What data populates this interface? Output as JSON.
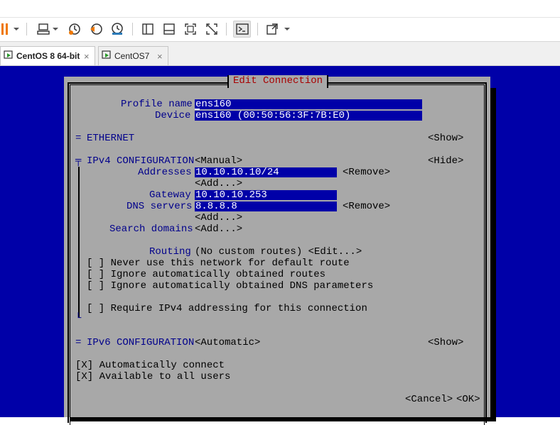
{
  "tabs": [
    {
      "label": "CentOS 8 64-bit",
      "close": "×",
      "active": true
    },
    {
      "label": "CentOS7",
      "close": "×",
      "active": false
    }
  ],
  "toolbar": {
    "icons": [
      "pause-icon",
      "send-keys-icon",
      "snapshot-take-icon",
      "snapshot-revert-icon",
      "snapshot-manager-icon",
      "sidebar-toggle-icon",
      "thumbnail-bar-icon",
      "fullscreen-icon",
      "unity-icon",
      "console-view-icon",
      "stretch-icon"
    ]
  },
  "dialog": {
    "title": "Edit Connection",
    "profile_name_label": "Profile name",
    "profile_name_value": "ens160",
    "device_label": "Device",
    "device_value": "ens160 (00:50:56:3F:7B:E0)",
    "ethernet_marker": "=",
    "ethernet_label": "ETHERNET",
    "ethernet_toggle": "<Show>",
    "ipv4_marker": "╤",
    "ipv4_label": "IPv4 CONFIGURATION",
    "ipv4_mode": "<Manual>",
    "ipv4_toggle": "<Hide>",
    "addresses_label": "Addresses",
    "address_value": "10.10.10.10/24",
    "remove_label": "<Remove>",
    "add_label": "<Add...>",
    "gateway_label": "Gateway",
    "gateway_value": "10.10.10.253",
    "dns_label": "DNS servers",
    "dns_value": "8.8.8.8",
    "search_domains_label": "Search domains",
    "routing_label": "Routing",
    "routing_value": "(No custom routes) <Edit...>",
    "opt_never_default": "[ ] Never use this network for default route",
    "opt_ignore_routes": "[ ] Ignore automatically obtained routes",
    "opt_ignore_dns": "[ ] Ignore automatically obtained DNS parameters",
    "opt_require_ipv4": "[ ] Require IPv4 addressing for this connection",
    "ipv4_end_marker": "└",
    "ipv6_marker": "=",
    "ipv6_label": "IPv6 CONFIGURATION",
    "ipv6_mode": "<Automatic>",
    "ipv6_toggle": "<Show>",
    "auto_connect": "[X] Automatically connect",
    "all_users": "[X] Available to all users",
    "cancel_label": "<Cancel>",
    "ok_label": "<OK>"
  },
  "colors": {
    "console_bg": "#0000a8",
    "dialog_bg": "#a8a8a8",
    "label": "#00008b",
    "title": "#a80000",
    "field_bg": "#0000a8",
    "field_text": "#ffffff"
  }
}
